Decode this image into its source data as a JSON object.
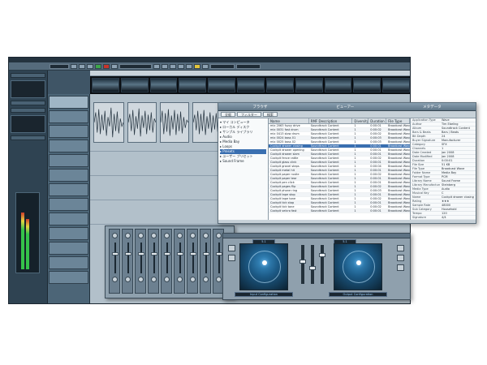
{
  "browser": {
    "title_left": "ブラウザ",
    "title_center": "ビューアー",
    "title_right": "メタデータ",
    "tabs": [
      "全般",
      "フィルター",
      "検索"
    ],
    "tree": [
      "▾ マイ コンピュータ",
      "  ▸ ローカル ディスク",
      "  ▸ サンプル ライブラリ",
      "    ▸ Audio",
      "    ▸ Media Bay",
      "    ▸ Loops",
      "    ▸ Presets",
      "  ▸ ユーザー プリセット",
      "▸ Sound Frame"
    ],
    "tree_selected_index": 6,
    "file_columns": [
      "Name",
      "RMF Description",
      "Diversity",
      "Duration",
      "File Type"
    ],
    "files": [
      [
        "mix 2063 fuzzy drive",
        "Soundtrack Content",
        "1",
        "0:00:01",
        "Broadcast Wave"
      ],
      [
        "mix 0031 fast drum",
        "Soundtrack Content",
        "1",
        "0:00:02",
        "Broadcast Wave"
      ],
      [
        "mix 0413 slow drum",
        "Soundtrack Content",
        "1",
        "0:00:02",
        "Broadcast Wave"
      ],
      [
        "mix 0024 bass 01",
        "Soundtrack Content",
        "1",
        "0:00:03",
        "Broadcast Wave"
      ],
      [
        "mix 0025 bass 02",
        "Soundtrack Content",
        "1",
        "0:00:03",
        "Broadcast Wave"
      ],
      [
        "Cockpit drawer closing",
        "Soundtrack Content",
        "1",
        "0:00:01",
        "Broadcast Wave"
      ],
      [
        "Cockpit drawer opening",
        "Soundtrack Content",
        "1",
        "0:00:01",
        "Broadcast Wave"
      ],
      [
        "Cockpit drawer slam",
        "Soundtrack Content",
        "1",
        "0:00:01",
        "Broadcast Wave"
      ],
      [
        "Cockpit fence rattle",
        "Soundtrack Content",
        "1",
        "0:00:02",
        "Broadcast Wave"
      ],
      [
        "Cockpit glass clink",
        "Soundtrack Content",
        "1",
        "0:00:01",
        "Broadcast Wave"
      ],
      [
        "Cockpit gravel steps",
        "Soundtrack Content",
        "1",
        "0:00:04",
        "Broadcast Wave"
      ],
      [
        "Cockpit metal hit",
        "Soundtrack Content",
        "1",
        "0:00:01",
        "Broadcast Wave"
      ],
      [
        "Cockpit paper rustle",
        "Soundtrack Content",
        "1",
        "0:00:02",
        "Broadcast Wave"
      ],
      [
        "Cockpit paper tear",
        "Soundtrack Content",
        "1",
        "0:00:01",
        "Broadcast Wave"
      ],
      [
        "Cockpit pen click",
        "Soundtrack Content",
        "1",
        "0:00:01",
        "Broadcast Wave"
      ],
      [
        "Cockpit pages flip",
        "Soundtrack Content",
        "1",
        "0:00:02",
        "Broadcast Wave"
      ],
      [
        "Cockpit phone ring",
        "Soundtrack Content",
        "1",
        "0:00:03",
        "Broadcast Wave"
      ],
      [
        "Cockpit tape stop",
        "Soundtrack Content",
        "1",
        "0:00:01",
        "Broadcast Wave"
      ],
      [
        "Cockpit tape tone",
        "Soundtrack Content",
        "1",
        "0:00:02",
        "Broadcast Wave"
      ],
      [
        "Cockpit tick stop",
        "Soundtrack Content",
        "1",
        "0:00:01",
        "Broadcast Wave"
      ],
      [
        "Cockpit tick tone",
        "Soundtrack Content",
        "1",
        "0:00:02",
        "Broadcast Wave"
      ],
      [
        "Cockpit velcro fast",
        "Soundtrack Content",
        "1",
        "0:00:01",
        "Broadcast Wave"
      ]
    ],
    "file_selected_index": 5,
    "attributes": [
      [
        "Application Type",
        "Wave"
      ],
      [
        "Author",
        "Tim Ebeling"
      ],
      [
        "Album",
        "Soundtrack Content"
      ],
      [
        "Bars & Beats",
        "Bars / Beats"
      ],
      [
        "Bit Depth",
        "24"
      ],
      [
        "Buyer Signature",
        "Manufacturer"
      ],
      [
        "Category",
        "SFX"
      ],
      [
        "Channels",
        "1"
      ],
      [
        "Date Created",
        "Jan 2008"
      ],
      [
        "Date Modified",
        "Jan 2008"
      ],
      [
        "Duration",
        "0:00:01"
      ],
      [
        "File Size",
        "51 KB"
      ],
      [
        "File Type",
        "Broadcast Wave"
      ],
      [
        "Folder Name",
        "Media Bay"
      ],
      [
        "Format Type",
        "PCM"
      ],
      [
        "Library Name",
        "Sound Frame"
      ],
      [
        "Library Manufacturer",
        "Steinberg"
      ],
      [
        "Media Type",
        "Audio"
      ],
      [
        "Musical Key",
        "C"
      ],
      [
        "Name",
        "Cockpit drawer closing"
      ],
      [
        "Rating",
        "★★★"
      ],
      [
        "Sample Rate",
        "48000"
      ],
      [
        "Sub Category",
        "Household"
      ],
      [
        "Tempo",
        "120"
      ],
      [
        "Signature",
        "4/4"
      ]
    ]
  },
  "surround": {
    "input_label": "Input Configuration",
    "output_label": "Output Configuration",
    "left_config": "5.1",
    "right_config": "5.1"
  },
  "colors": {
    "daw_bg": "#3f5566",
    "selection": "#3a6fb0",
    "panner_blue": "#3a90c8"
  }
}
